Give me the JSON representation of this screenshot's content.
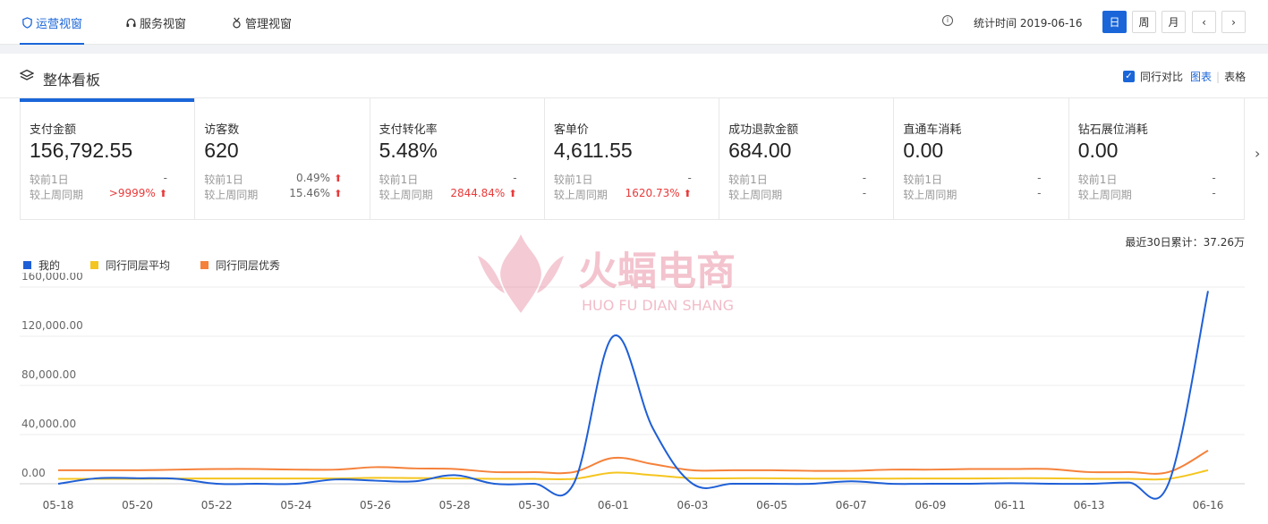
{
  "nav": {
    "tabs": [
      {
        "label": "运营视窗",
        "active": true
      },
      {
        "label": "服务视窗",
        "active": false
      },
      {
        "label": "管理视窗",
        "active": false
      }
    ],
    "stat_time_label": "统计时间 2019-06-16",
    "periods": [
      "日",
      "周",
      "月"
    ],
    "prev": "‹",
    "next": "›"
  },
  "section": {
    "title": "整体看板",
    "compare_label": "同行对比",
    "view_chart": "图表",
    "view_table": "表格"
  },
  "cards": [
    {
      "label": "支付金额",
      "value": "156,792.55",
      "day_label": "较前1日",
      "day_pct": "-",
      "week_label": "较上周同期",
      "week_pct": ">9999%",
      "week_up": true
    },
    {
      "label": "访客数",
      "value": "620",
      "day_label": "较前1日",
      "day_pct": "0.49%",
      "day_up": true,
      "week_label": "较上周同期",
      "week_pct": "15.46%",
      "week_up": true
    },
    {
      "label": "支付转化率",
      "value": "5.48%",
      "day_label": "较前1日",
      "day_pct": "-",
      "week_label": "较上周同期",
      "week_pct": "2844.84%",
      "week_up": true
    },
    {
      "label": "客单价",
      "value": "4,611.55",
      "day_label": "较前1日",
      "day_pct": "-",
      "week_label": "较上周同期",
      "week_pct": "1620.73%",
      "week_up": true
    },
    {
      "label": "成功退款金额",
      "value": "684.00",
      "day_label": "较前1日",
      "day_pct": "-",
      "week_label": "较上周同期",
      "week_pct": "-"
    },
    {
      "label": "直通车消耗",
      "value": "0.00",
      "day_label": "较前1日",
      "day_pct": "-",
      "week_label": "较上周同期",
      "week_pct": "-"
    },
    {
      "label": "钻石展位消耗",
      "value": "0.00",
      "day_label": "较前1日",
      "day_pct": "-",
      "week_label": "较上周同期",
      "week_pct": "-"
    }
  ],
  "arrow_up": "⬆",
  "summary": "最近30日累计：37.26万",
  "watermark": {
    "cn": "火蝠电商",
    "en": "HUO FU DIAN SHANG"
  },
  "colors": {
    "accent": "#1a66d9",
    "mine": "#1f5fd6",
    "avg": "#f5c51f",
    "best": "#f5813a",
    "up": "#e83a3a"
  },
  "chart_data": {
    "type": "line",
    "x": [
      "05-18",
      "05-19",
      "05-20",
      "05-21",
      "05-22",
      "05-23",
      "05-24",
      "05-25",
      "05-26",
      "05-27",
      "05-28",
      "05-29",
      "05-30",
      "05-31",
      "06-01",
      "06-02",
      "06-03",
      "06-04",
      "06-05",
      "06-06",
      "06-07",
      "06-08",
      "06-09",
      "06-10",
      "06-11",
      "06-12",
      "06-13",
      "06-14",
      "06-15",
      "06-16"
    ],
    "x_tick_labels": [
      "05-18",
      "05-20",
      "05-22",
      "05-24",
      "05-26",
      "05-28",
      "05-30",
      "06-01",
      "06-03",
      "06-05",
      "06-07",
      "06-09",
      "06-11",
      "06-13",
      "06-16"
    ],
    "y_tick_labels": [
      "0.00",
      "40,000.00",
      "80,000.00",
      "120,000.00",
      "160,000.00"
    ],
    "ylim": [
      0,
      160000
    ],
    "grid": true,
    "legend_position": "top-left",
    "series": [
      {
        "name": "我的",
        "values": [
          0,
          4500,
          4500,
          4000,
          0,
          0,
          0,
          3500,
          2500,
          2000,
          7000,
          0,
          0,
          0,
          120000,
          45000,
          0,
          0,
          0,
          0,
          2000,
          0,
          0,
          0,
          500,
          0,
          0,
          1000,
          0,
          156792
        ]
      },
      {
        "name": "同行同层平均",
        "values": [
          4000,
          4000,
          4000,
          4200,
          4300,
          4300,
          4300,
          4300,
          4800,
          4600,
          4400,
          4000,
          4000,
          4000,
          9000,
          7000,
          4500,
          4500,
          4500,
          4200,
          4200,
          4200,
          4300,
          4300,
          4500,
          4500,
          4000,
          4000,
          4000,
          11000
        ]
      },
      {
        "name": "同行同层优秀",
        "values": [
          11000,
          11000,
          11000,
          11500,
          12000,
          12000,
          11500,
          11500,
          13500,
          12500,
          12000,
          9500,
          9500,
          9500,
          21000,
          16000,
          11000,
          11000,
          11000,
          10500,
          10500,
          11500,
          11500,
          12000,
          12000,
          12000,
          9500,
          9500,
          9500,
          27000
        ]
      }
    ]
  }
}
